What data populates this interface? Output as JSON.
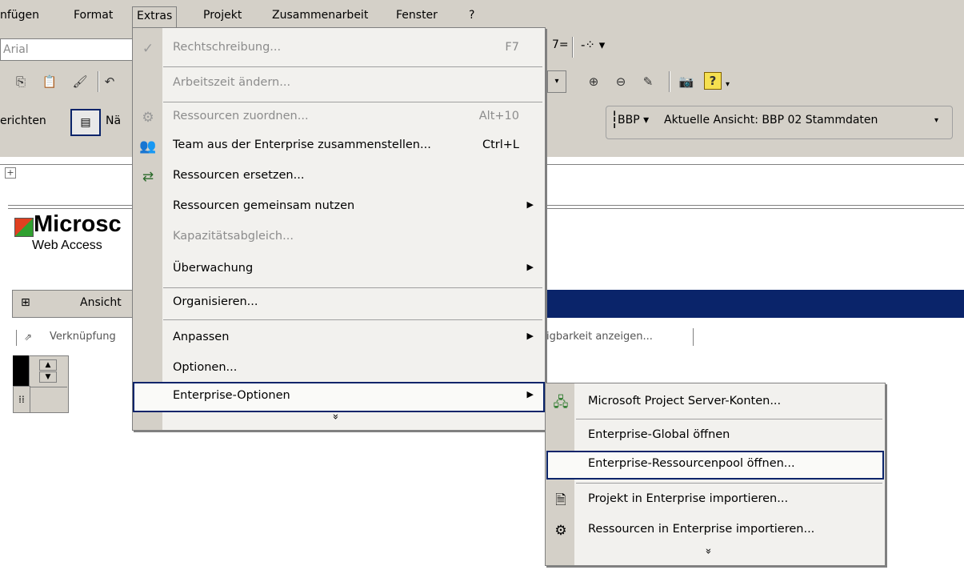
{
  "menubar": {
    "items": [
      {
        "label": "nfügen"
      },
      {
        "label": "Format"
      },
      {
        "label": "Extras"
      },
      {
        "label": "Projekt"
      },
      {
        "label": "Zusammenarbeit"
      },
      {
        "label": "Fenster"
      },
      {
        "label": "?"
      }
    ]
  },
  "toolbar": {
    "font_name": "Arial",
    "view_label": "erichten",
    "view_label2": "Nä",
    "bbp": "BBP ▾",
    "current_view": "Aktuelle Ansicht: BBP 02 Stammdaten"
  },
  "content": {
    "logo_title": "Microsc",
    "logo_sub": "Web Access",
    "panel_title": "Ansicht",
    "links_left": "Verknüpfung",
    "links_right": "igbarkeit anzeigen..."
  },
  "extras_menu": {
    "items": [
      {
        "label": "Rechtschreibung...",
        "shortcut": "F7",
        "icon": "spellcheck-icon",
        "disabled": true
      },
      {
        "label": "Arbeitszeit ändern...",
        "disabled": true
      },
      {
        "label": "Ressourcen zuordnen...",
        "shortcut": "Alt+10",
        "icon": "assign-resources-icon",
        "disabled": true
      },
      {
        "label": "Team aus der Enterprise zusammenstellen...",
        "shortcut": "Ctrl+L",
        "icon": "build-team-icon"
      },
      {
        "label": "Ressourcen ersetzen...",
        "icon": "replace-resources-icon"
      },
      {
        "label": "Ressourcen gemeinsam nutzen",
        "submenu": true
      },
      {
        "label": "Kapazitätsabgleich...",
        "disabled": true
      },
      {
        "label": "Überwachung",
        "submenu": true
      },
      {
        "label": "Organisieren..."
      },
      {
        "label": "Anpassen",
        "submenu": true
      },
      {
        "label": "Optionen..."
      },
      {
        "label": "Enterprise-Optionen",
        "submenu": true,
        "highlighted": true
      }
    ],
    "expand": "»"
  },
  "enterprise_submenu": {
    "items": [
      {
        "label": "Microsoft Project Server-Konten...",
        "icon": "server-accounts-icon"
      },
      {
        "label": "Enterprise-Global öffnen"
      },
      {
        "label": "Enterprise-Ressourcenpool öffnen...",
        "highlighted": true
      },
      {
        "label": "Projekt in Enterprise importieren...",
        "icon": "import-project-icon"
      },
      {
        "label": "Ressourcen in Enterprise importieren...",
        "icon": "import-resources-icon"
      }
    ],
    "expand": "»"
  }
}
